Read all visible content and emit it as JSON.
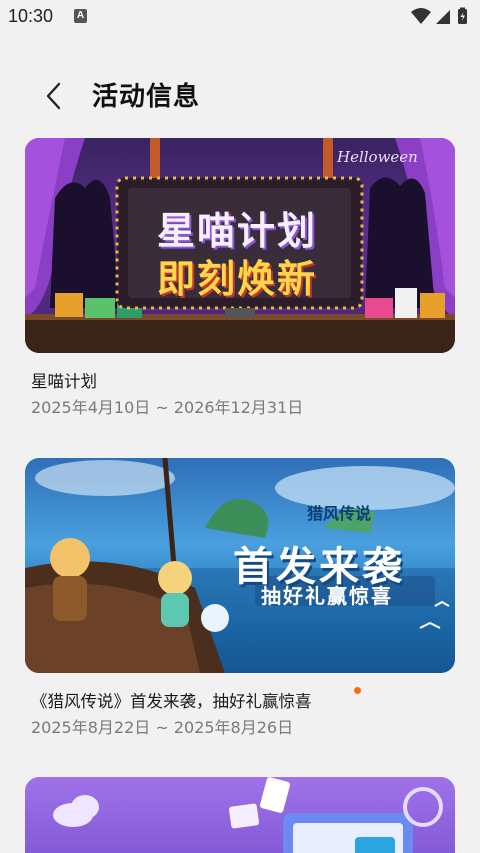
{
  "status": {
    "time": "10:30",
    "notification_icon": "A"
  },
  "header": {
    "back_icon": "chevron-left-icon",
    "title": "活动信息"
  },
  "activities": [
    {
      "banner_line1": "星喵计划",
      "banner_line2": "即刻焕新",
      "banner_tag": "Helloween",
      "title": "星喵计划",
      "date": "2025年4月10日 ~ 2026年12月31日",
      "is_new": false
    },
    {
      "banner_logo": "猎风传说",
      "banner_line1": "首发来袭",
      "banner_line2": "抽好礼赢惊喜",
      "title": "《猎风传说》首发来袭，抽好礼赢惊喜",
      "date": "2025年8月22日 ~ 2025年8月26日",
      "is_new": true,
      "dot_color": "#ff6a13"
    },
    {
      "title": "",
      "date": ""
    }
  ],
  "colors": {
    "background": "#f1f1f1",
    "accent_dot": "#ff6a13",
    "date_text": "#7a7a7a"
  }
}
